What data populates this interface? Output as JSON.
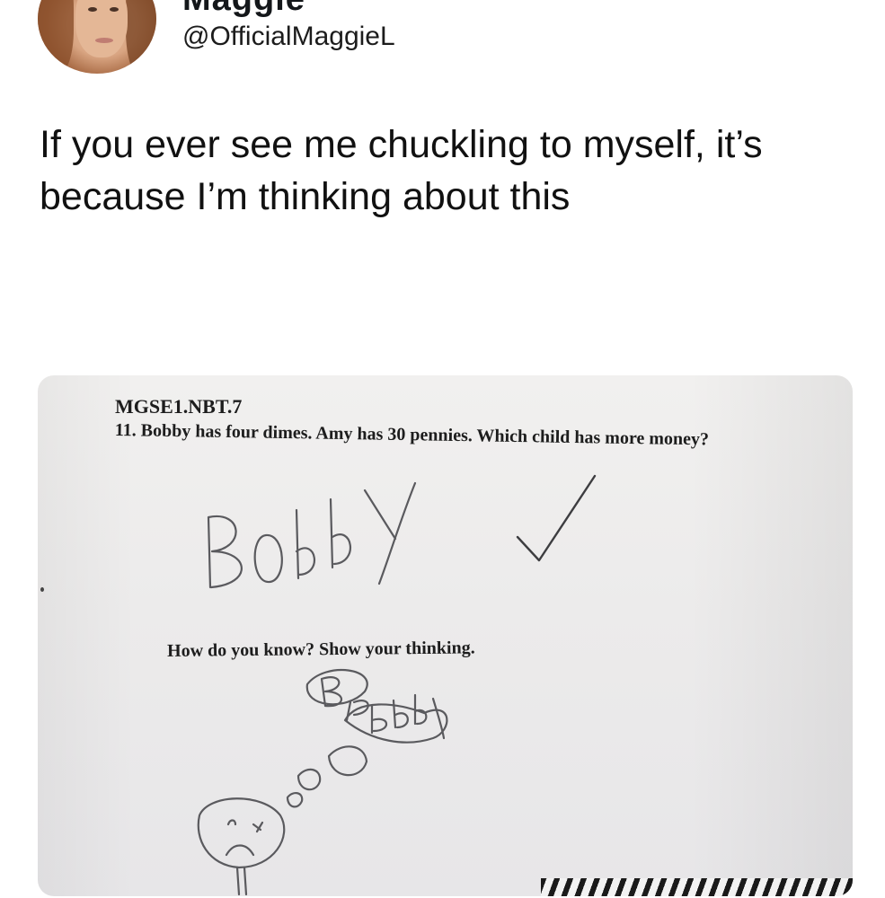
{
  "tweet": {
    "display_name": "Maggie",
    "handle": "@OfficialMaggieL",
    "text": "If you ever see me chuckling to myself, it’s because I’m thinking about this"
  },
  "worksheet": {
    "standard_code": "MGSE1.NBT.7",
    "question": "11. Bobby has four dimes. Amy has 30 pennies. Which child has more money?",
    "prompt": "How do you know? Show your thinking.",
    "handwritten_answer": "Bobby",
    "handwritten_thinking": "Bobby"
  }
}
